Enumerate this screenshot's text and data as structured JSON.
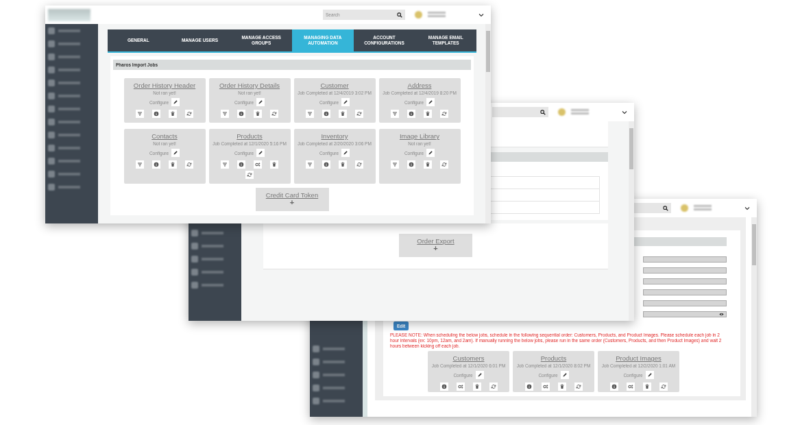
{
  "front_window": {
    "search": {
      "placeholder": "Search"
    },
    "tabs": [
      {
        "label": "GENERAL",
        "selected": false
      },
      {
        "label": "MANAGE USERS",
        "selected": false
      },
      {
        "label": "MANAGE ACCESS GROUPS",
        "selected": false
      },
      {
        "label": "MANAGING DATA AUTOMATION",
        "selected": true
      },
      {
        "label": "ACCOUNT CONFIGURATIONS",
        "selected": false
      },
      {
        "label": "MANAGE EMAIL TEMPLATES",
        "selected": false
      }
    ],
    "section_title": "Pharos Import Jobs",
    "jobs": [
      {
        "title": "Order History Header",
        "status": "Not ran yet!",
        "configure": "Configure",
        "actions": [
          {
            "kind": "filter"
          },
          {
            "kind": "info"
          },
          {
            "kind": "trash"
          },
          {
            "kind": "refresh"
          }
        ]
      },
      {
        "title": "Order History Details",
        "status": "Not ran yet!",
        "configure": "Configure",
        "actions": [
          {
            "kind": "filter"
          },
          {
            "kind": "info"
          },
          {
            "kind": "trash"
          },
          {
            "kind": "refresh"
          }
        ]
      },
      {
        "title": "Customer",
        "status": "Job Completed at 12/4/2019 3:02 PM",
        "configure": "Configure",
        "actions": [
          {
            "kind": "filter"
          },
          {
            "kind": "info"
          },
          {
            "kind": "trash"
          },
          {
            "kind": "refresh"
          }
        ]
      },
      {
        "title": "Address",
        "status": "Job Completed at 12/4/2019 8:20 PM",
        "configure": "Configure",
        "actions": [
          {
            "kind": "filter"
          },
          {
            "kind": "info"
          },
          {
            "kind": "trash"
          },
          {
            "kind": "refresh"
          }
        ]
      },
      {
        "title": "Contacts",
        "status": "Not ran yet!",
        "configure": "Configure",
        "actions": [
          {
            "kind": "filter"
          },
          {
            "kind": "info"
          },
          {
            "kind": "trash"
          },
          {
            "kind": "refresh"
          }
        ]
      },
      {
        "title": "Products",
        "status": "Job Completed at 12/1/2020 5:16 PM",
        "configure": "Configure",
        "actions": [
          {
            "kind": "filter"
          },
          {
            "kind": "info"
          },
          {
            "kind": "gears"
          },
          {
            "kind": "trash"
          },
          {
            "kind": "refresh"
          }
        ]
      },
      {
        "title": "Inventory",
        "status": "Job Completed at 2/20/2020 3:06 PM",
        "configure": "Configure",
        "actions": [
          {
            "kind": "filter"
          },
          {
            "kind": "info"
          },
          {
            "kind": "trash"
          },
          {
            "kind": "refresh"
          }
        ]
      },
      {
        "title": "Image Library",
        "status": "Not ran yet!",
        "configure": "Configure",
        "actions": [
          {
            "kind": "filter"
          },
          {
            "kind": "info"
          },
          {
            "kind": "trash"
          },
          {
            "kind": "refresh"
          }
        ]
      }
    ],
    "add_job": {
      "title": "Credit Card Token",
      "icon": "+"
    }
  },
  "middle_window": {
    "add_job": {
      "title": "Order Export",
      "icon": "+"
    }
  },
  "back_window": {
    "edit_button": "Edit",
    "note": "PLEASE NOTE: When scheduling the below jobs, schedule in the following sequential order: Customers, Products, and Product Images. Please schedule each job in 2 hour intervals (ex: 10pm, 12am, and 2am). If manually running the below jobs, please run in the same order (Customers, Products, and then Product Images) and wait 2 hours between kicking off each job.",
    "jobs": [
      {
        "title": "Customers",
        "status": "Job Completed at 12/1/2020 6:01 PM",
        "configure": "Configure",
        "actions": [
          {
            "kind": "info"
          },
          {
            "kind": "gears"
          },
          {
            "kind": "trash"
          },
          {
            "kind": "refresh"
          }
        ]
      },
      {
        "title": "Products",
        "status": "Job Completed at 12/1/2020 8:02 PM",
        "configure": "Configure",
        "actions": [
          {
            "kind": "info"
          },
          {
            "kind": "gears"
          },
          {
            "kind": "trash"
          },
          {
            "kind": "refresh"
          }
        ]
      },
      {
        "title": "Product Images",
        "status": "Job Completed at 12/2/2020 1:01 AM",
        "configure": "Configure",
        "actions": [
          {
            "kind": "info"
          },
          {
            "kind": "gears"
          },
          {
            "kind": "trash"
          },
          {
            "kind": "refresh"
          }
        ]
      }
    ]
  }
}
